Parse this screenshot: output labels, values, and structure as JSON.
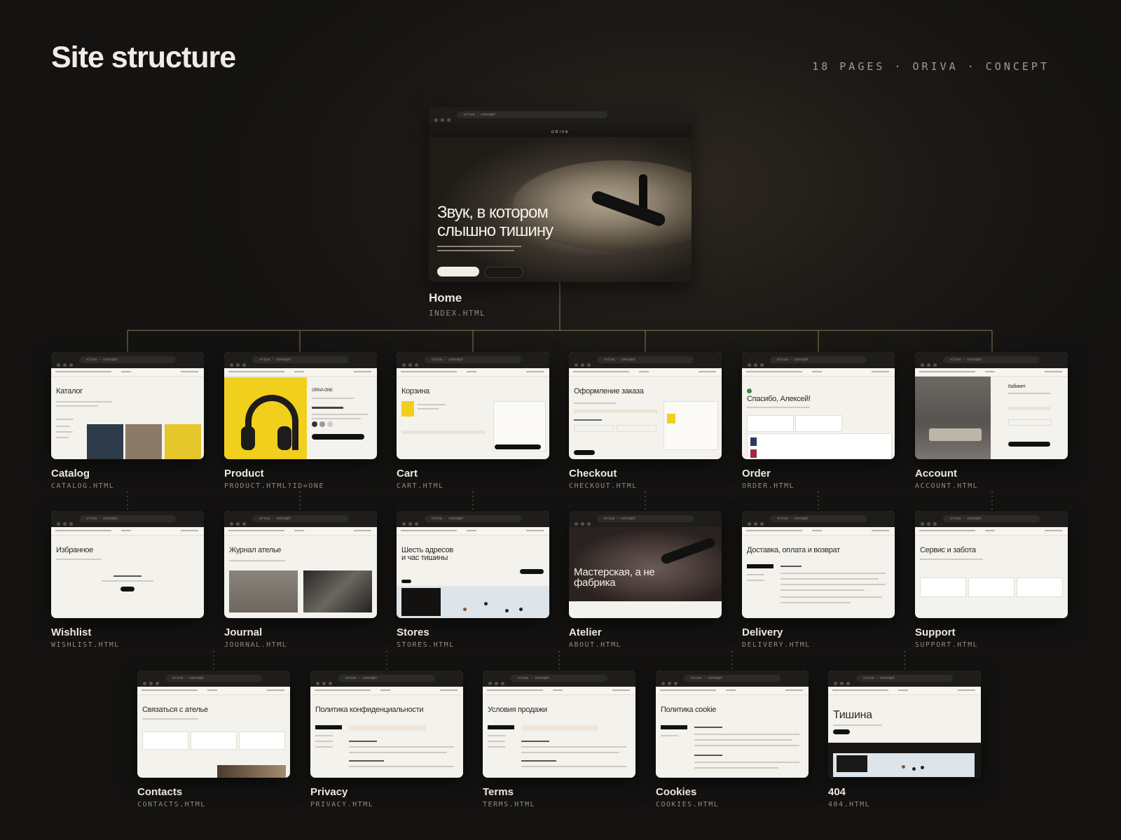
{
  "header": {
    "title": "Site structure",
    "meta": "18 PAGES · ORIVA · CONCEPT"
  },
  "browser_url": "oriva · concept",
  "home": {
    "label": "Home",
    "file": "INDEX.HTML",
    "hero_title_line1": "Звук, в котором",
    "hero_title_line2": "слышно тишину",
    "brand": "ORIVA"
  },
  "pages": [
    {
      "label": "Catalog",
      "file": "CATALOG.HTML",
      "heading": "Каталог"
    },
    {
      "label": "Product",
      "file": "PRODUCT.HTML?ID=ONE",
      "heading": "ORIVA ONE"
    },
    {
      "label": "Cart",
      "file": "CART.HTML",
      "heading": "Корзина"
    },
    {
      "label": "Checkout",
      "file": "CHECKOUT.HTML",
      "heading": "Оформление заказа"
    },
    {
      "label": "Order",
      "file": "ORDER.HTML",
      "heading": "Спасибо, Алексей!"
    },
    {
      "label": "Account",
      "file": "ACCOUNT.HTML",
      "heading": "Кабинет"
    },
    {
      "label": "Wishlist",
      "file": "WISHLIST.HTML",
      "heading": "Избранное"
    },
    {
      "label": "Journal",
      "file": "JOURNAL.HTML",
      "heading": "Журнал ателье"
    },
    {
      "label": "Stores",
      "file": "STORES.HTML",
      "heading": "Шесть адресов и час тишины"
    },
    {
      "label": "Atelier",
      "file": "ABOUT.HTML",
      "heading": "Мастерская, а не фабрика"
    },
    {
      "label": "Delivery",
      "file": "DELIVERY.HTML",
      "heading": "Доставка, оплата и возврат"
    },
    {
      "label": "Support",
      "file": "SUPPORT.HTML",
      "heading": "Сервис и забота"
    },
    {
      "label": "Contacts",
      "file": "CONTACTS.HTML",
      "heading": "Связаться с ателье"
    },
    {
      "label": "Privacy",
      "file": "PRIVACY.HTML",
      "heading": "Политика конфиденциальности"
    },
    {
      "label": "Terms",
      "file": "TERMS.HTML",
      "heading": "Условия продажи"
    },
    {
      "label": "Cookies",
      "file": "COOKIES.HTML",
      "heading": "Политика cookie"
    },
    {
      "label": "404",
      "file": "404.HTML",
      "heading": "Тишина"
    }
  ]
}
